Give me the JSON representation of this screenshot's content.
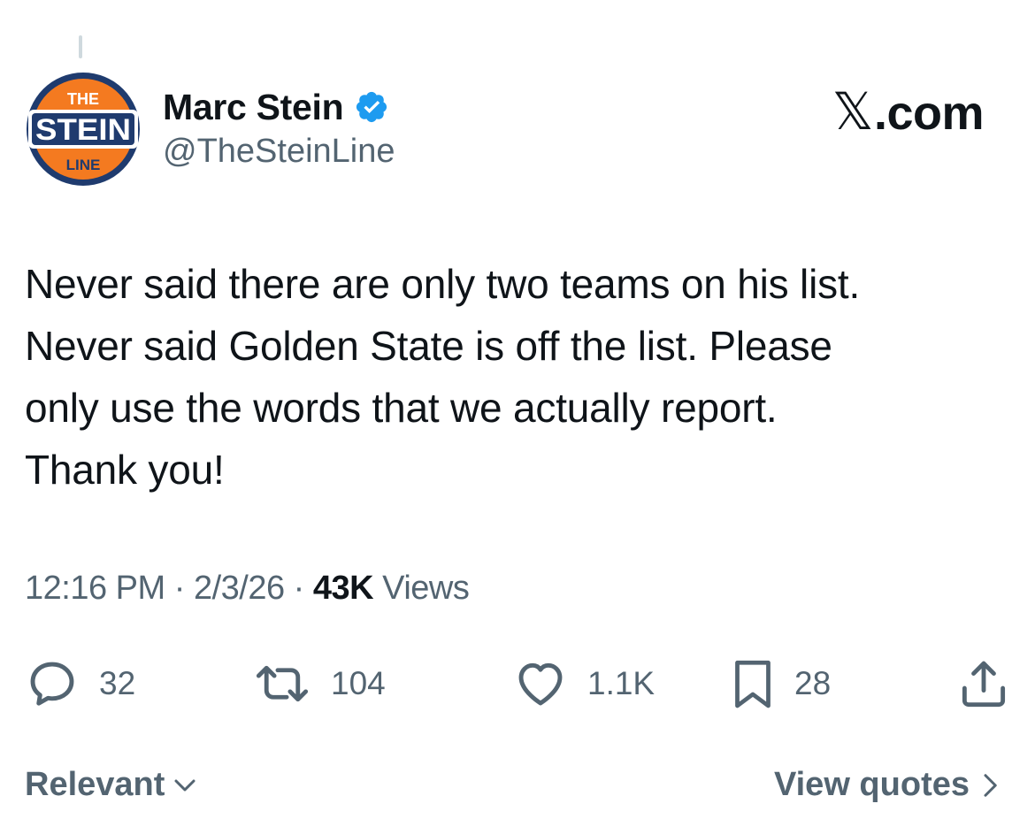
{
  "author": {
    "display_name": "Marc Stein",
    "handle": "@TheSteinLine",
    "verified": true,
    "avatar_logo_text": [
      "THE",
      "STEIN",
      "LINE"
    ]
  },
  "site_mark": {
    "x": "𝕏",
    "domain": ".com"
  },
  "tweet": {
    "text": "Never said there are only two teams on his list.\nNever said Golden State is off the list. Please\nonly use the words that we actually report.\nThank you!"
  },
  "meta": {
    "time": "12:16 PM",
    "separator": " · ",
    "date": "2/3/26",
    "views_count": "43K",
    "views_label": "Views"
  },
  "actions": {
    "replies": "32",
    "reposts": "104",
    "likes": "1.1K",
    "bookmarks": "28"
  },
  "footer": {
    "sort_label": "Relevant",
    "quotes_label": "View quotes"
  },
  "colors": {
    "text_primary": "#0f1419",
    "text_secondary": "#536471",
    "verified_blue": "#1d9bf0",
    "logo_orange": "#f47a20",
    "logo_navy": "#1f3b6e",
    "thread_line": "#cfd9de"
  },
  "icons": {
    "reply": "speech-bubble-icon",
    "repost": "repost-arrows-icon",
    "like": "heart-icon",
    "bookmark": "bookmark-icon",
    "share": "share-upload-icon",
    "verified": "verified-badge-icon"
  }
}
